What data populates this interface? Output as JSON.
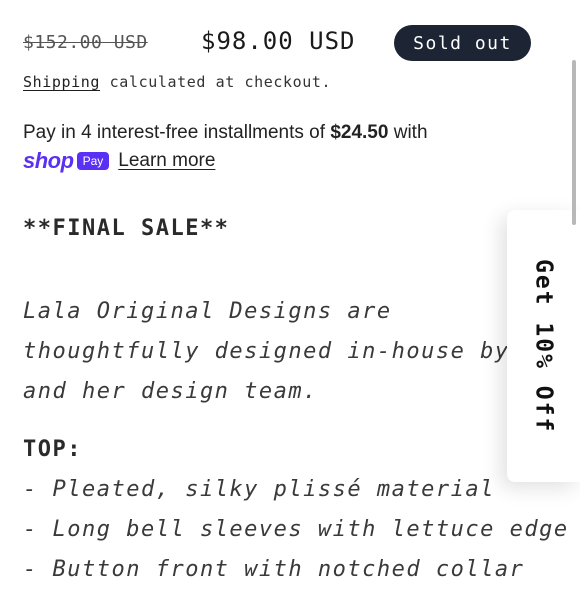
{
  "price": {
    "compare_at": "$152.00 USD",
    "current": "$98.00 USD",
    "badge": "Sold out"
  },
  "shipping": {
    "link": "Shipping",
    "text": " calculated at checkout."
  },
  "shop_pay": {
    "installment_prefix": "Pay in 4 interest-free installments of ",
    "installment_amount": "$24.50",
    "installment_suffix": " with",
    "logo_shop": "shop",
    "logo_pay": "Pay",
    "learn_more": "Learn more",
    "brand_color": "#5a31f4"
  },
  "description": {
    "final_sale": "**FINAL SALE**",
    "line1": "Lala Original Designs are",
    "line2": "thoughtfully designed in-house by",
    "line3": "and her design team.",
    "top_heading": "TOP:",
    "top_items": [
      "- Pleated, silky plissé material",
      "- Long bell sleeves with lettuce edge",
      "- Button front with notched collar"
    ]
  },
  "discount_tab": {
    "label": "Get 10% Off"
  }
}
